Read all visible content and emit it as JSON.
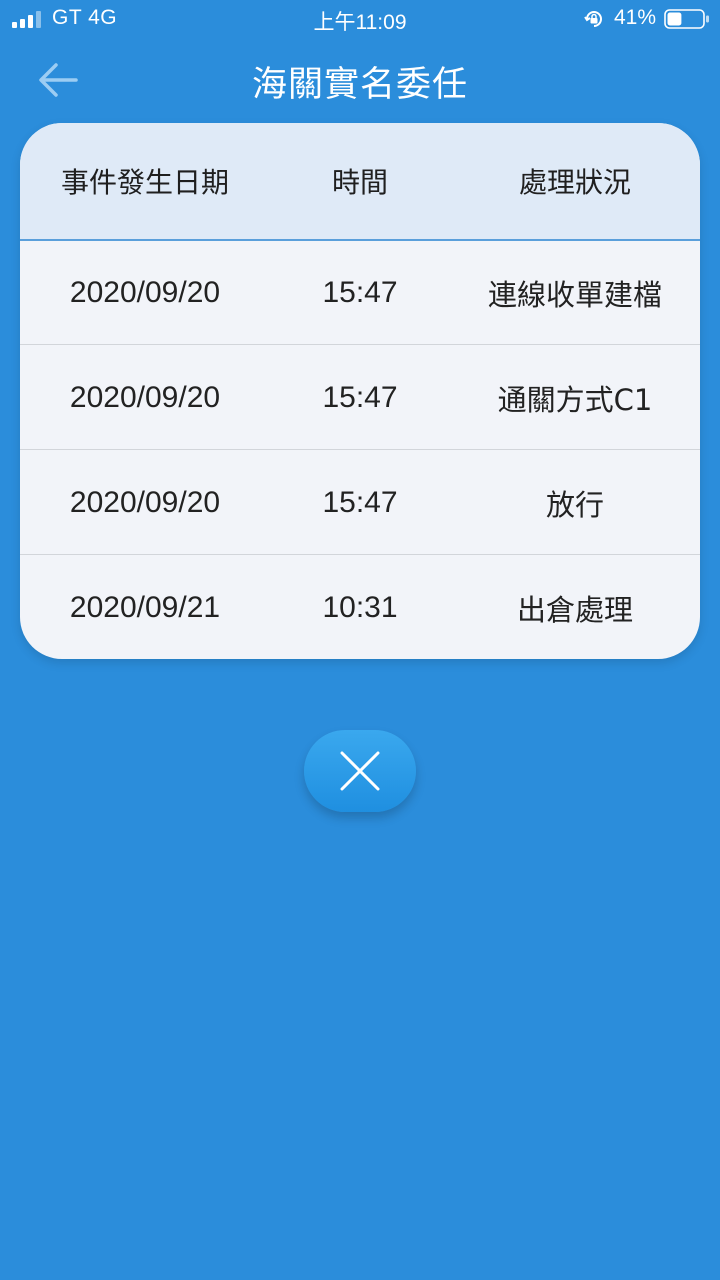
{
  "status_bar": {
    "carrier": "GT 4G",
    "time": "上午11:09",
    "battery": "41%",
    "battery_level": 0.41,
    "icons": [
      "signal-icon",
      "orientation-lock-icon",
      "battery-icon"
    ]
  },
  "header": {
    "title": "海關實名委任",
    "back_icon": "arrow-left-icon"
  },
  "table": {
    "columns": [
      "事件發生日期",
      "時間",
      "處理狀況"
    ],
    "rows": [
      {
        "date": "2020/09/20",
        "time": "15:47",
        "status": "連線收單建檔"
      },
      {
        "date": "2020/09/20",
        "time": "15:47",
        "status": "通關方式C1"
      },
      {
        "date": "2020/09/20",
        "time": "15:47",
        "status": "放行"
      },
      {
        "date": "2020/09/21",
        "time": "10:31",
        "status": "出倉處理"
      }
    ]
  },
  "close_button": {
    "icon": "close-icon"
  },
  "colors": {
    "background": "#2b8ddb",
    "card": "#f2f4f9",
    "header_row": "#dfeaf7",
    "header_border": "#5a9fdb",
    "close_button": "#2a9be8"
  }
}
